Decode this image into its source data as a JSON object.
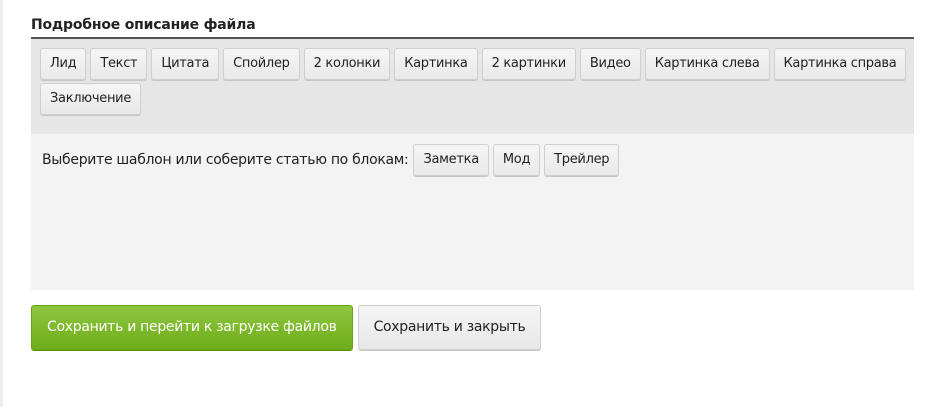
{
  "section": {
    "title": "Подробное описание файла"
  },
  "toolbar": {
    "row1": [
      "Лид",
      "Текст",
      "Цитата",
      "Спойлер",
      "2 колонки",
      "Картинка",
      "2 картинки",
      "Видео",
      "Картинка слева",
      "Картинка справа"
    ],
    "row2": [
      "Заключение"
    ]
  },
  "templates": {
    "label": "Выберите шаблон или соберите статью по блокам:",
    "items": [
      "Заметка",
      "Мод",
      "Трейлер"
    ]
  },
  "actions": {
    "save_and_upload": "Сохранить и перейти к загрузке файлов",
    "save_and_close": "Сохранить и закрыть"
  },
  "colors": {
    "primary": "#7ab829",
    "toolbar_bg": "#e6e6e6",
    "editor_bg": "#f3f3f3"
  }
}
